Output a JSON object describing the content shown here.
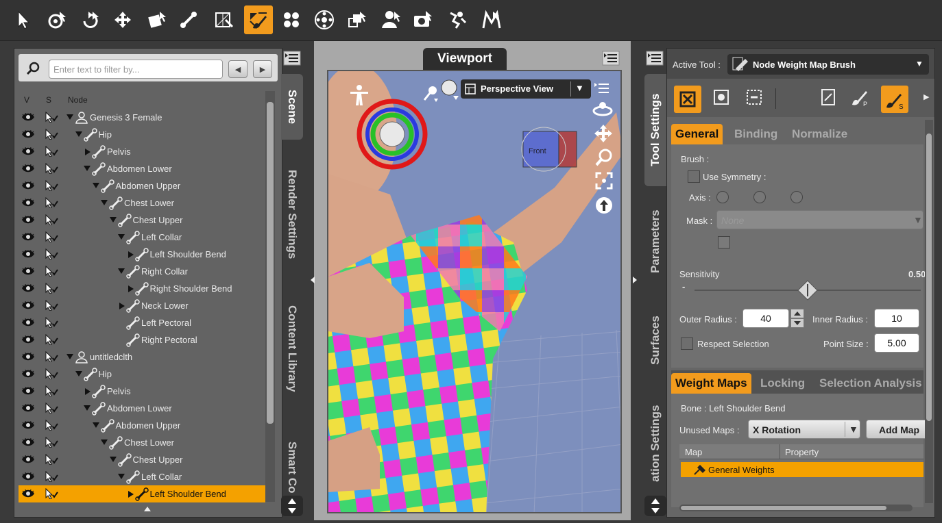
{
  "toolbar": {
    "tools": [
      {
        "name": "node-selection-tool-icon"
      },
      {
        "name": "universal-tool-icon"
      },
      {
        "name": "rotate-tool-icon"
      },
      {
        "name": "translate-tool-icon"
      },
      {
        "name": "scale-tool-icon"
      },
      {
        "name": "joint-editor-tool-icon"
      },
      {
        "name": "geometry-editor-tool-icon"
      },
      {
        "name": "node-weight-map-brush-icon",
        "active": true
      },
      {
        "name": "surface-selection-tool-icon"
      },
      {
        "name": "spot-render-tool-icon"
      },
      {
        "name": "region-navigator-tool-icon"
      },
      {
        "name": "figure-tool-icon"
      },
      {
        "name": "camera-tool-icon"
      },
      {
        "name": "pose-tool-icon"
      },
      {
        "name": "morph-tool-icon"
      }
    ]
  },
  "scene": {
    "filter_placeholder": "Enter text to filter by...",
    "columns": {
      "v": "V",
      "s": "S",
      "node": "Node"
    },
    "rows": [
      {
        "label": "Genesis 3 Female",
        "depth": 0,
        "expander": "down",
        "icon": "figure"
      },
      {
        "label": "Hip",
        "depth": 1,
        "expander": "down",
        "icon": "bone"
      },
      {
        "label": "Pelvis",
        "depth": 2,
        "expander": "right",
        "icon": "bone"
      },
      {
        "label": "Abdomen Lower",
        "depth": 2,
        "expander": "down",
        "icon": "bone"
      },
      {
        "label": "Abdomen Upper",
        "depth": 3,
        "expander": "down",
        "icon": "bone"
      },
      {
        "label": "Chest Lower",
        "depth": 4,
        "expander": "down",
        "icon": "bone"
      },
      {
        "label": "Chest Upper",
        "depth": 5,
        "expander": "down",
        "icon": "bone"
      },
      {
        "label": "Left Collar",
        "depth": 6,
        "expander": "down",
        "icon": "bone"
      },
      {
        "label": "Left Shoulder Bend",
        "depth": 7,
        "expander": "right",
        "icon": "bone"
      },
      {
        "label": "Right Collar",
        "depth": 6,
        "expander": "down",
        "icon": "bone"
      },
      {
        "label": "Right Shoulder Bend",
        "depth": 7,
        "expander": "right",
        "icon": "bone"
      },
      {
        "label": "Neck Lower",
        "depth": 6,
        "expander": "right",
        "icon": "bone"
      },
      {
        "label": "Left Pectoral",
        "depth": 6,
        "expander": "none",
        "icon": "bone"
      },
      {
        "label": "Right Pectoral",
        "depth": 6,
        "expander": "none",
        "icon": "bone"
      },
      {
        "label": "untitledclth",
        "depth": 0,
        "expander": "down",
        "icon": "figure"
      },
      {
        "label": "Hip",
        "depth": 1,
        "expander": "down",
        "icon": "bone"
      },
      {
        "label": "Pelvis",
        "depth": 2,
        "expander": "right",
        "icon": "bone"
      },
      {
        "label": "Abdomen Lower",
        "depth": 2,
        "expander": "down",
        "icon": "bone"
      },
      {
        "label": "Abdomen Upper",
        "depth": 3,
        "expander": "down",
        "icon": "bone"
      },
      {
        "label": "Chest Lower",
        "depth": 4,
        "expander": "down",
        "icon": "bone"
      },
      {
        "label": "Chest Upper",
        "depth": 5,
        "expander": "down",
        "icon": "bone"
      },
      {
        "label": "Left Collar",
        "depth": 6,
        "expander": "down",
        "icon": "bone"
      },
      {
        "label": "Left Shoulder Bend",
        "depth": 7,
        "expander": "right",
        "icon": "bone",
        "selected": true
      }
    ]
  },
  "left_tabs": [
    "Scene",
    "Render Settings",
    "Content Library",
    "Smart Co"
  ],
  "viewport": {
    "tab_label": "Viewport",
    "view_label": "Perspective View",
    "cube_label": "Front"
  },
  "right_tabs": [
    "Tool Settings",
    "Parameters",
    "Surfaces",
    "ation Settings"
  ],
  "tool_settings": {
    "active_tool_label": "Active Tool :",
    "active_tool_value": "Node Weight Map Brush",
    "brush_tabs": [
      "General",
      "Binding",
      "Normalize"
    ],
    "brush_label": "Brush :",
    "use_symmetry": "Use Symmetry :",
    "axis_label": "Axis :",
    "mask_label": "Mask :",
    "mask_value": "None",
    "sensitivity_label": "Sensitivity",
    "sensitivity_value": "0.50",
    "sensitivity_fraction": 0.5,
    "outer_radius_label": "Outer Radius :",
    "outer_radius_value": "40",
    "inner_radius_label": "Inner Radius :",
    "inner_radius_value": "10",
    "respect_selection": "Respect Selection",
    "point_size_label": "Point Size :",
    "point_size_value": "5.00",
    "map_tabs": [
      "Weight Maps",
      "Locking",
      "Selection Analysis"
    ],
    "bone_label": "Bone : Left Shoulder Bend",
    "unused_maps_label": "Unused Maps :",
    "unused_maps_value": "X Rotation",
    "add_map_label": "Add Map",
    "table_headers": [
      "Map",
      "Property"
    ],
    "table_rows": [
      {
        "map": "General Weights",
        "property": ""
      }
    ]
  },
  "colors": {
    "accent": "#f29b1d",
    "selection": "#f4a100",
    "viewport_bg": "#7d8fbd"
  }
}
